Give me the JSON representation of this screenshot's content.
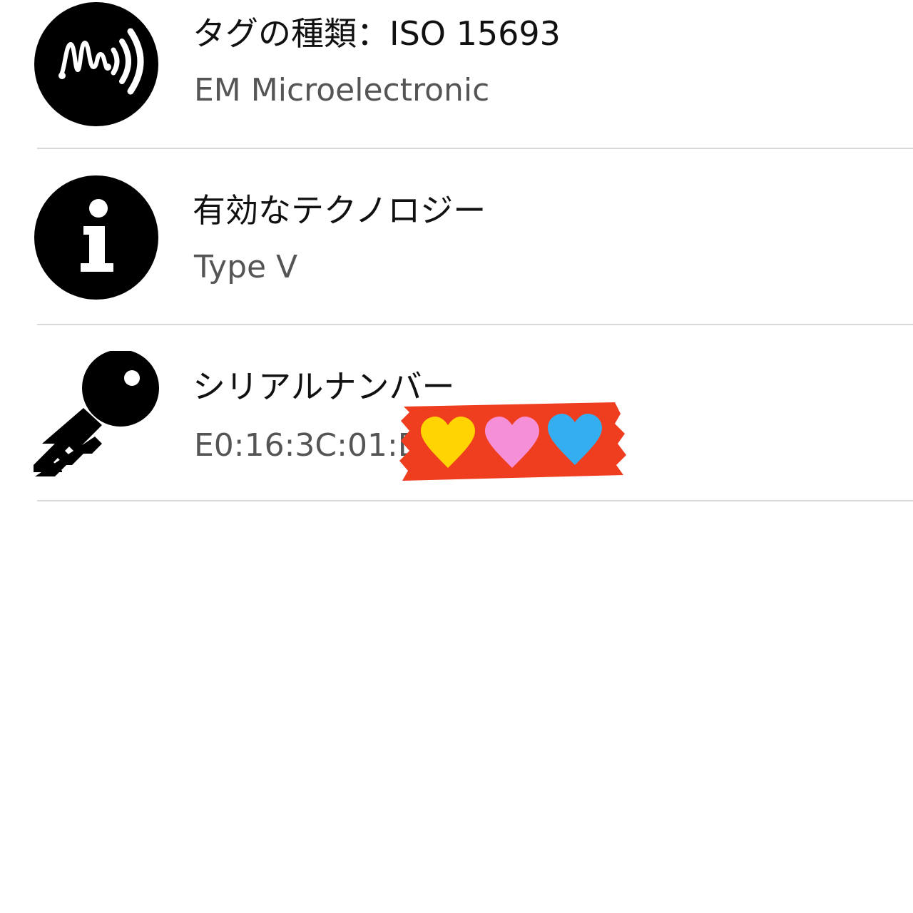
{
  "rows": [
    {
      "icon": "nfc-tag-icon",
      "title": "タグの種類：ISO 15693",
      "subtitle": "EM Microelectronic"
    },
    {
      "icon": "info-icon",
      "title": "有効なテクノロジー",
      "subtitle": "Type V"
    },
    {
      "icon": "key-icon",
      "title": "シリアルナンバー",
      "subtitle": "E0:16:3C:01:D"
    }
  ],
  "redaction_sticker": {
    "hearts": [
      "yellow",
      "pink",
      "blue"
    ],
    "colors": {
      "tape": "#ef3e1f",
      "yellow": "#ffd400",
      "pink": "#f58fd8",
      "blue": "#34aef0"
    }
  },
  "colors": {
    "text_primary": "#111111",
    "text_secondary": "#555555",
    "divider": "#d8d8da",
    "icon": "#000000"
  }
}
